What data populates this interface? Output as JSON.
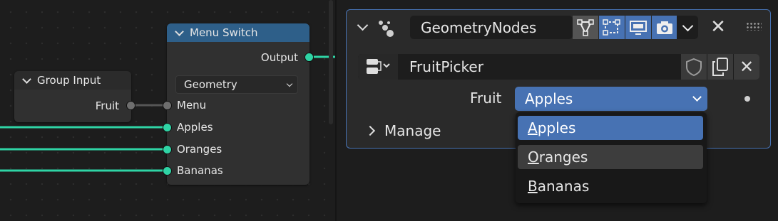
{
  "node_editor": {
    "group_input": {
      "title": "Group Input",
      "outputs": [
        "Fruit"
      ]
    },
    "menu_switch": {
      "title": "Menu Switch",
      "output": "Output",
      "type_value": "Geometry",
      "inputs": [
        "Menu",
        "Apples",
        "Oranges",
        "Bananas"
      ]
    }
  },
  "modifier": {
    "name": "GeometryNodes",
    "node_group": "FruitPicker",
    "input_label": "Fruit",
    "input_value": "Apples",
    "manage_label": "Manage"
  },
  "dropdown_menu": {
    "items": [
      {
        "label": "Apples",
        "mnemonic": "A",
        "rest": "pples"
      },
      {
        "label": "Oranges",
        "mnemonic": "O",
        "rest": "ranges"
      },
      {
        "label": "Bananas",
        "mnemonic": "B",
        "rest": "ananas"
      }
    ]
  },
  "colors": {
    "accent": "#4772b3",
    "node_header_menu_switch": "#2e5f89",
    "node_header_group_input": "#2b2b2b",
    "socket_geometry": "#2fd4a5",
    "socket_menu": "#6e6e6e"
  },
  "icons": [
    "node-tree-icon",
    "modifier-icon",
    "edit-mode-icon",
    "realtime-icon",
    "render-icon",
    "close-icon",
    "grip-icon",
    "fake-user-icon",
    "duplicate-icon"
  ]
}
